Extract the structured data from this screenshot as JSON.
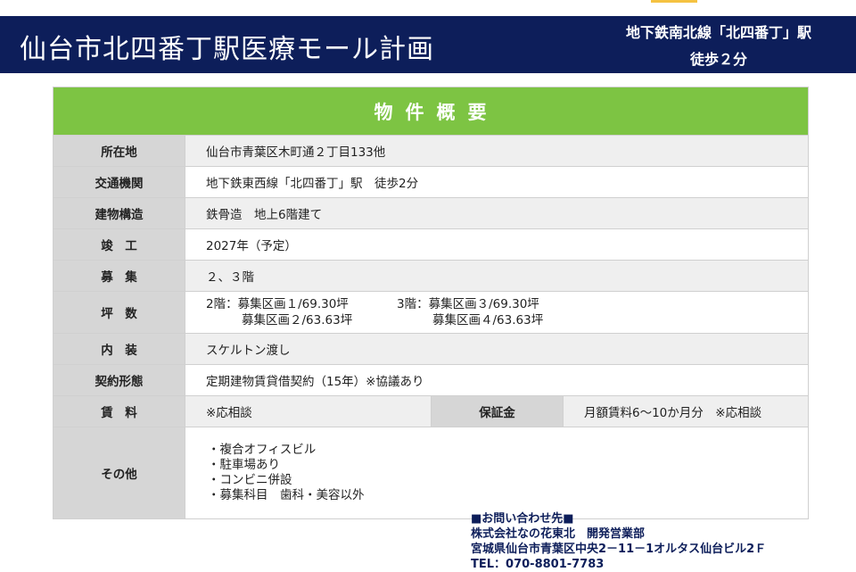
{
  "header": {
    "title": "仙台市北四番丁駅医療モール計画",
    "access_line1": "地下鉄南北線「北四番丁」駅",
    "access_line2": "徒歩２分"
  },
  "outline": {
    "heading": "物件概要",
    "rows": {
      "location": {
        "label": "所在地",
        "value": "仙台市青葉区木町通２丁目133他"
      },
      "transport": {
        "label": "交通機関",
        "value": "地下鉄東西線「北四番丁」駅　徒歩2分"
      },
      "structure": {
        "label": "建物構造",
        "value": "鉄骨造　地上6階建て"
      },
      "completion": {
        "label": "竣　工",
        "value": "2027年（予定）"
      },
      "recruit": {
        "label": "募　集",
        "value": "２、３階"
      },
      "area": {
        "label": "坪　数",
        "items": [
          "2階：募集区画１/69.30坪",
          "3階：募集区画３/69.30坪",
          "募集区画２/63.63坪",
          "募集区画４/63.63坪"
        ]
      },
      "interior": {
        "label": "内　装",
        "value": "スケルトン渡し"
      },
      "contract": {
        "label": "契約形態",
        "value": "定期建物賃貸借契約（15年）※協議あり"
      },
      "rent": {
        "label": "賃　料",
        "value": "※応相談",
        "deposit_label": "保証金",
        "deposit_value": "月額賃料6～10か月分　※応相談"
      },
      "others": {
        "label": "その他",
        "items": [
          "・複合オフィスビル",
          "・駐車場あり",
          "・コンビニ併設",
          "・募集科目　歯科・美容以外"
        ]
      }
    }
  },
  "contact": {
    "heading": "■お問い合わせ先■",
    "company": "株式会社なの花東北　開発営業部",
    "address": "宮城県仙台市青葉区中央2－11－1オルタス仙台ビル2Ｆ",
    "tel": "TEL：070-8801-7783"
  },
  "colors": {
    "header_bg": "#0d1e5a",
    "heading_green": "#7dc443",
    "label_gray": "#d6d6d6",
    "accent": "#f5c242"
  }
}
